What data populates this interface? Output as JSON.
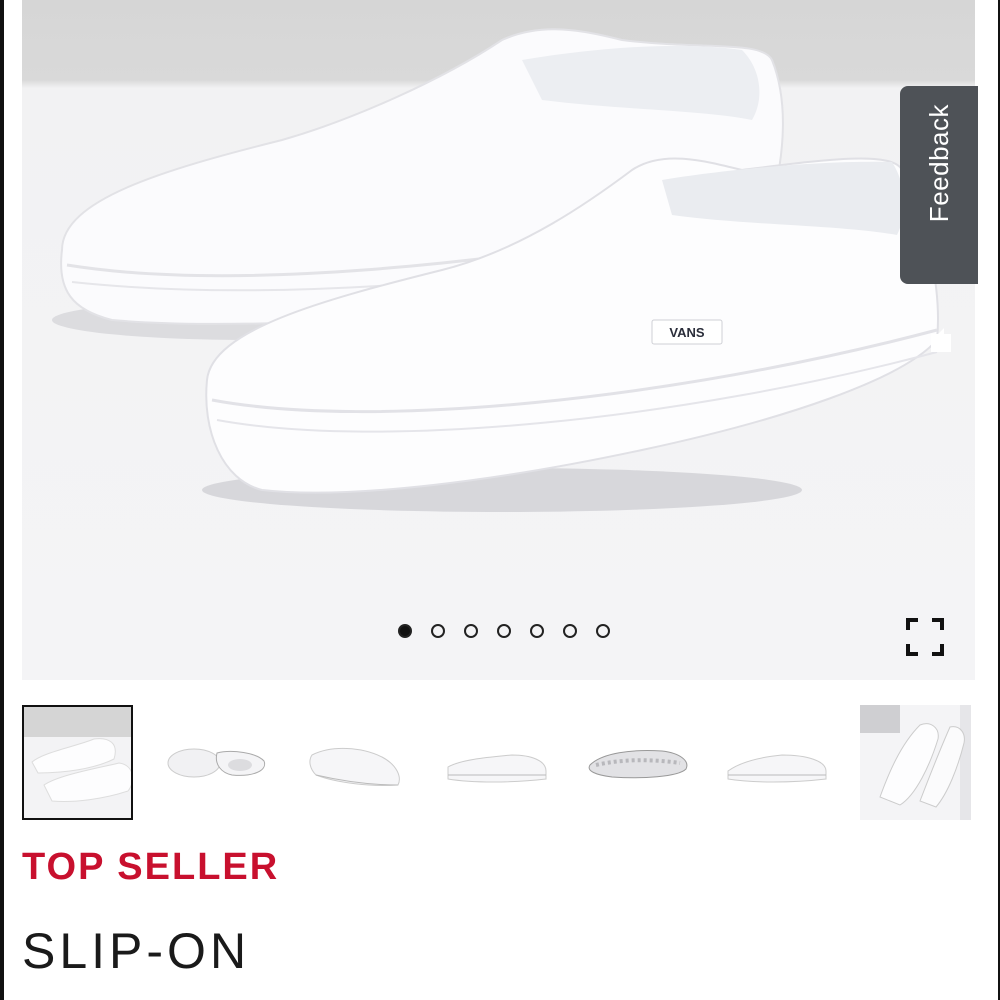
{
  "hero": {
    "image_alt": "White canvas slip-on sneakers",
    "logo_text": "VANS",
    "carousel": {
      "count": 7,
      "active_index": 0
    }
  },
  "icons": {
    "fullscreen": "fullscreen-icon",
    "feedback": "comment-icon"
  },
  "feedback": {
    "label": "Feedback"
  },
  "thumbnails": [
    {
      "alt": "Pair angled view"
    },
    {
      "alt": "Top view"
    },
    {
      "alt": "Side view"
    },
    {
      "alt": "Profile view"
    },
    {
      "alt": "Outsole view"
    },
    {
      "alt": "Outer side view"
    },
    {
      "alt": "Heel pair view"
    }
  ],
  "product": {
    "badge": "TOP SELLER",
    "name": "SLIP-ON"
  },
  "colors": {
    "badge": "#c8102e",
    "feedback_bg": "#4e5257",
    "text": "#1a1a1a"
  }
}
